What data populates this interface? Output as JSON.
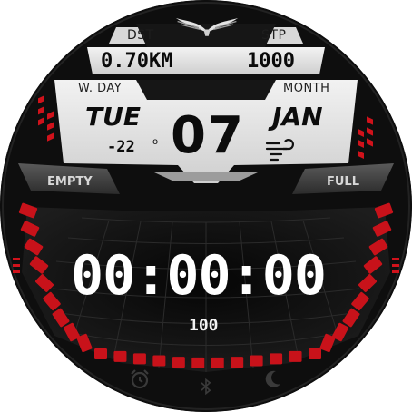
{
  "top": {
    "distance_label": "DST",
    "distance_value": "0.70KM",
    "steps_label": "STP",
    "steps_value": "1000"
  },
  "date_panel": {
    "weekday_label": "W. DAY",
    "weekday": "TUE",
    "month_label": "MONTH",
    "month": "JAN",
    "day": "07",
    "temperature": "-22",
    "temperature_unit": "o"
  },
  "battery": {
    "empty_label": "EMPTY",
    "full_label": "FULL",
    "level_value": "100"
  },
  "time": "00:00:00",
  "icons": {
    "logo": "winged-logo-icon",
    "weather": "windy-weather-icon",
    "alarm": "alarm-clock-icon",
    "bluetooth": "bluetooth-icon",
    "night": "moon-icon"
  },
  "colors": {
    "accent_red": "#d0121b",
    "panel_light": "#e6e6e6",
    "background": "#0b0b0b"
  }
}
